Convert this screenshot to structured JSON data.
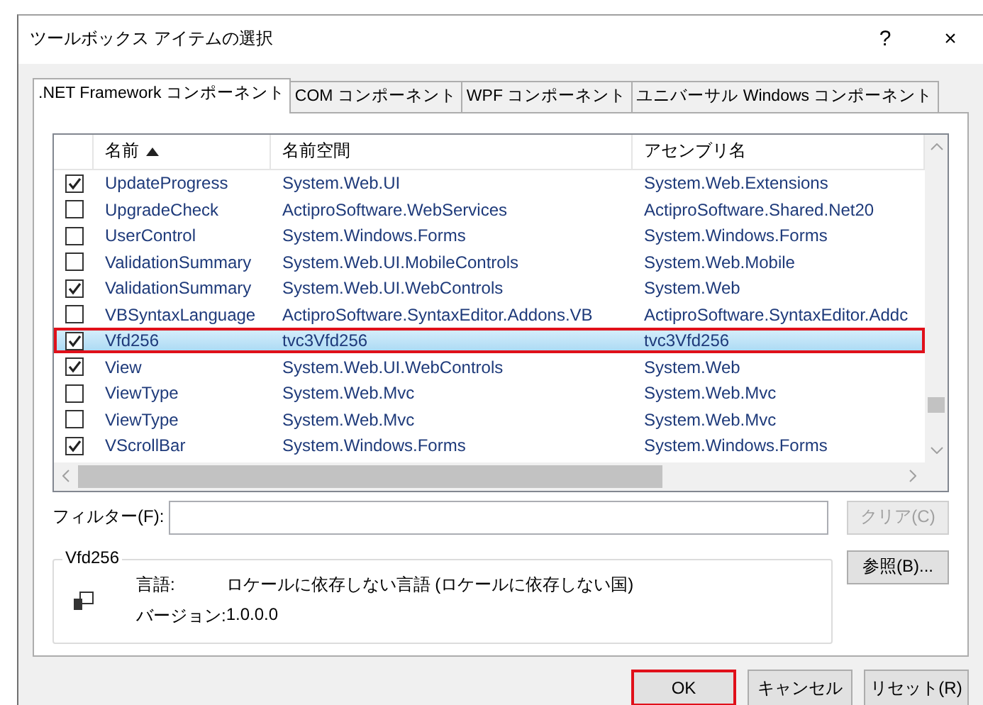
{
  "window": {
    "title": "ツールボックス アイテムの選択",
    "help": "?",
    "close": "×"
  },
  "tabs": [
    {
      "label": ".NET Framework コンポーネント",
      "selected": true
    },
    {
      "label": "COM コンポーネント",
      "selected": false
    },
    {
      "label": "WPF コンポーネント",
      "selected": false
    },
    {
      "label": "ユニバーサル Windows コンポーネント",
      "selected": false
    }
  ],
  "table": {
    "columns": [
      {
        "label": "名前",
        "sorted": true
      },
      {
        "label": "名前空間",
        "sorted": false
      },
      {
        "label": "アセンブリ名",
        "sorted": false
      }
    ],
    "rows": [
      {
        "checked": true,
        "selected": false,
        "marked": false,
        "cells": [
          "UpdateProgress",
          "System.Web.UI",
          "System.Web.Extensions"
        ]
      },
      {
        "checked": false,
        "selected": false,
        "marked": false,
        "cells": [
          "UpgradeCheck",
          "ActiproSoftware.WebServices",
          "ActiproSoftware.Shared.Net20"
        ]
      },
      {
        "checked": false,
        "selected": false,
        "marked": false,
        "cells": [
          "UserControl",
          "System.Windows.Forms",
          "System.Windows.Forms"
        ]
      },
      {
        "checked": false,
        "selected": false,
        "marked": false,
        "cells": [
          "ValidationSummary",
          "System.Web.UI.MobileControls",
          "System.Web.Mobile"
        ]
      },
      {
        "checked": true,
        "selected": false,
        "marked": false,
        "cells": [
          "ValidationSummary",
          "System.Web.UI.WebControls",
          "System.Web"
        ]
      },
      {
        "checked": false,
        "selected": false,
        "marked": false,
        "cells": [
          "VBSyntaxLanguage",
          "ActiproSoftware.SyntaxEditor.Addons.VB",
          "ActiproSoftware.SyntaxEditor.Addc"
        ]
      },
      {
        "checked": true,
        "selected": true,
        "marked": true,
        "cells": [
          "Vfd256",
          "tvc3Vfd256",
          "tvc3Vfd256"
        ]
      },
      {
        "checked": true,
        "selected": false,
        "marked": false,
        "cells": [
          "View",
          "System.Web.UI.WebControls",
          "System.Web"
        ]
      },
      {
        "checked": false,
        "selected": false,
        "marked": false,
        "cells": [
          "ViewType",
          "System.Web.Mvc",
          "System.Web.Mvc"
        ]
      },
      {
        "checked": false,
        "selected": false,
        "marked": false,
        "cells": [
          "ViewType",
          "System.Web.Mvc",
          "System.Web.Mvc"
        ]
      },
      {
        "checked": true,
        "selected": false,
        "marked": false,
        "cells": [
          "VScrollBar",
          "System.Windows.Forms",
          "System.Windows.Forms"
        ]
      }
    ]
  },
  "filter": {
    "label": "フィルター(F):",
    "clear_button": {
      "label": "クリア(C)",
      "disabled": true
    }
  },
  "details": {
    "title": "Vfd256",
    "language_label": "言語:",
    "language": "ロケールに依存しない言語 (ロケールに依存しない国)",
    "version_label": "バージョン:",
    "version": "1.0.0.0"
  },
  "browse_button": "参照(B)...",
  "buttons": [
    {
      "label": "OK",
      "marked": true
    },
    {
      "label": "キャンセル",
      "marked": false
    },
    {
      "label": "リセット(R)",
      "marked": false
    }
  ]
}
